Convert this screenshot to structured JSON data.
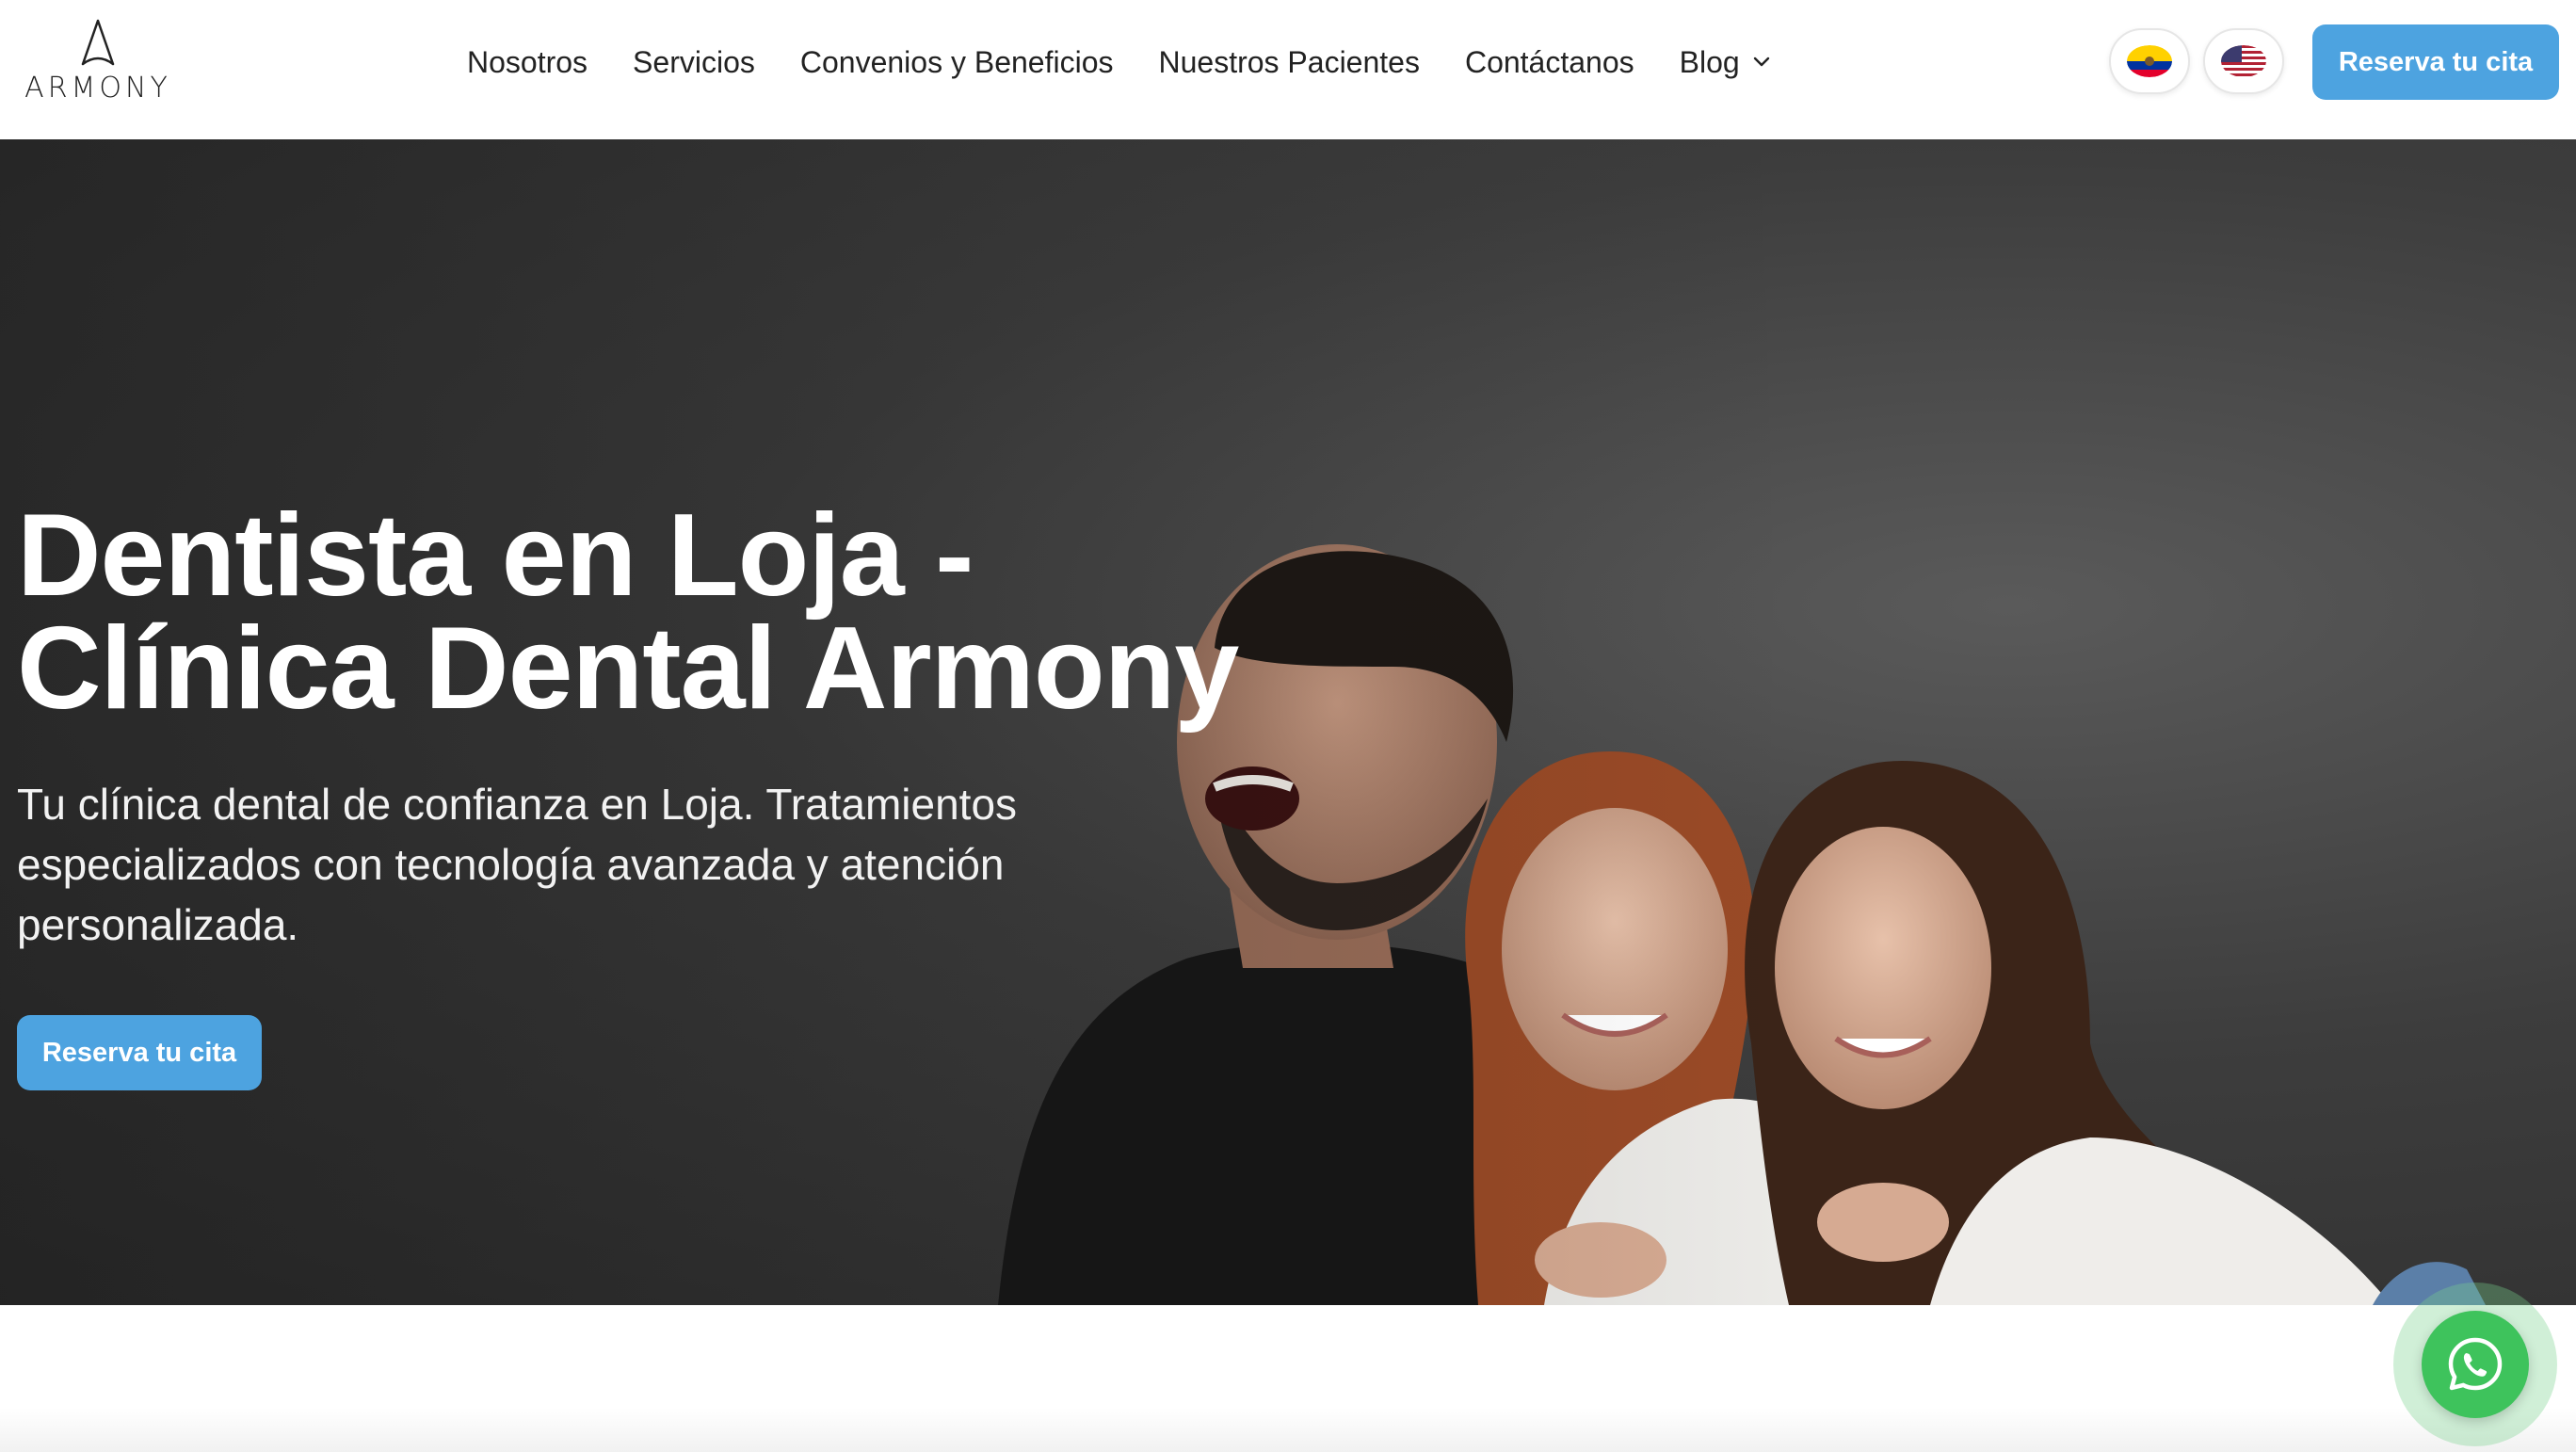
{
  "brand": {
    "logo_text": "ARMONY",
    "accent": "#4da3e0",
    "whatsapp_green": "#3ec35c"
  },
  "nav": {
    "items": [
      {
        "label": "Nosotros"
      },
      {
        "label": "Servicios"
      },
      {
        "label": "Convenios y Beneficios"
      },
      {
        "label": "Nuestros Pacientes"
      },
      {
        "label": "Contáctanos"
      },
      {
        "label": "Blog",
        "icon": "chevron-down-icon"
      }
    ]
  },
  "languages": [
    {
      "icon": "ecuador-flag-icon"
    },
    {
      "icon": "usa-flag-icon"
    }
  ],
  "header": {
    "cta_label": "Reserva tu cita"
  },
  "hero": {
    "title_line1": "Dentista en Loja -",
    "title_line2": "Clínica Dental Armony",
    "subtitle": "Tu clínica dental de confianza en Loja. Tratamientos especializados con tecnología avanzada y atención personalizada.",
    "cta_label": "Reserva tu cita",
    "image": "three-smiling-people-photo"
  },
  "floating": {
    "icon": "whatsapp-icon"
  }
}
